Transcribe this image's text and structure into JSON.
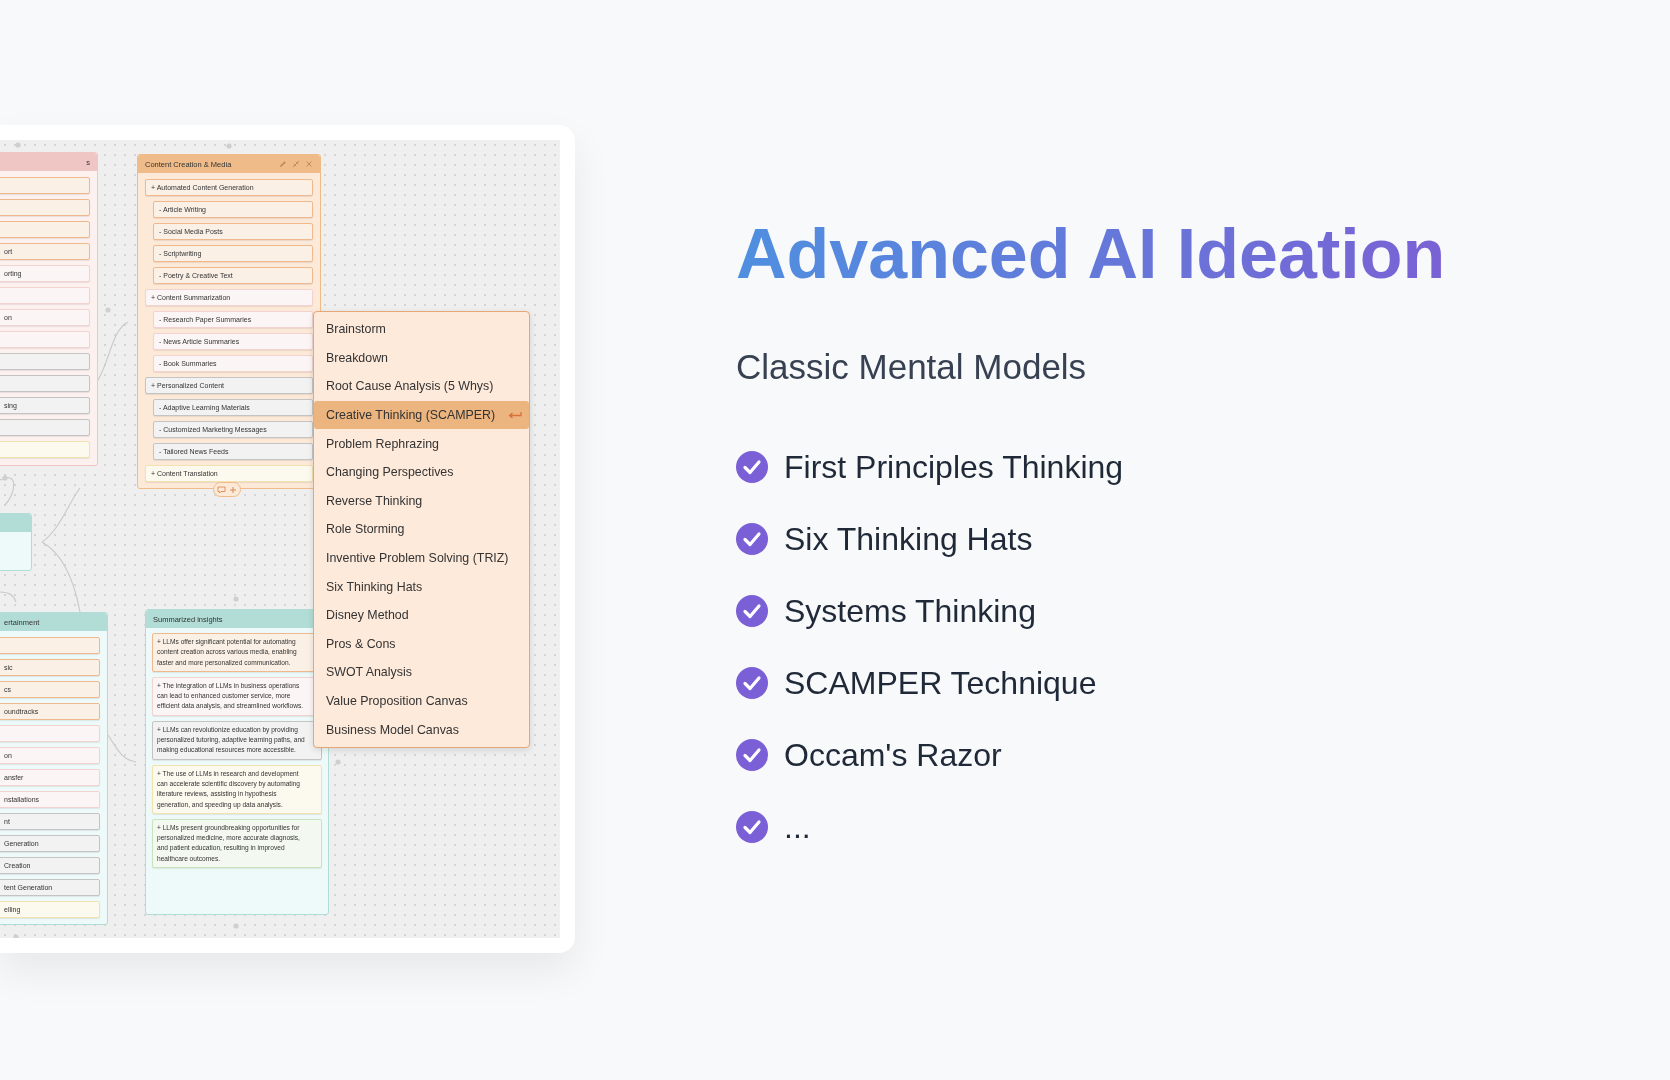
{
  "canvas": {
    "partial_node_top": {
      "title": "s",
      "rows": [
        {
          "color": "#efb98d"
        },
        {
          "color": "#efb98d"
        },
        {
          "color": "#efb98d"
        },
        {
          "text": "ort",
          "color": "#efb98d"
        },
        {
          "text": "orting",
          "color": "#f1d3d0"
        },
        {
          "color": "#f1d3d0"
        },
        {
          "text": "on",
          "color": "#f1d3d0"
        },
        {
          "color": "#f1d3d0"
        },
        {
          "color": "#c4c4c4"
        },
        {
          "color": "#c4c4c4"
        },
        {
          "text": "sing",
          "color": "#c4c4c4"
        },
        {
          "color": "#c4c4c4"
        },
        {
          "color": "#f1e2b0"
        }
      ]
    },
    "partial_node_bottom": {
      "title": "ertainment",
      "rows": [
        {
          "color": "#efb98d"
        },
        {
          "text": "sic",
          "color": "#efb98d"
        },
        {
          "text": "cs",
          "color": "#efb98d"
        },
        {
          "text": "oundtracks",
          "color": "#efb98d"
        },
        {
          "color": "#f1d3d0"
        },
        {
          "text": "on",
          "color": "#f1d3d0"
        },
        {
          "text": "ansfer",
          "color": "#f1d3d0"
        },
        {
          "text": "nstallations",
          "color": "#f1d3d0"
        },
        {
          "text": "nt",
          "color": "#c4c4c4"
        },
        {
          "text": "Generation",
          "color": "#c4c4c4"
        },
        {
          "text": "Creation",
          "color": "#c4c4c4"
        },
        {
          "text": "tent Generation",
          "color": "#c4c4c4"
        },
        {
          "text": "elling",
          "color": "#f1e2b0"
        }
      ]
    },
    "content_node": {
      "title": "Content Creation & Media",
      "groups": [
        {
          "label": "+ Automated Content Generation",
          "color": "#efb98d",
          "children": [
            "- Article Writing",
            "- Social Media Posts",
            "- Scriptwriting",
            "- Poetry & Creative Text"
          ]
        },
        {
          "label": "+ Content Summarization",
          "color": "#f1d3d0",
          "children": [
            "- Research Paper Summaries",
            "- News Article Summaries",
            "- Book Summaries"
          ]
        },
        {
          "label": "+ Personalized Content",
          "color": "#c4c4c4",
          "children": [
            "- Adaptive Learning Materials",
            "- Customized Marketing Messages",
            "- Tailored News Feeds"
          ]
        },
        {
          "label": "+ Content Translation",
          "color": "#f1e2b0"
        }
      ]
    },
    "insights_node": {
      "title": "Summarized insights",
      "cards": [
        {
          "text": "+ LLMs offer significant potential for automating content creation across various media, enabling faster and more personalized communication.",
          "color": "#efb98d"
        },
        {
          "text": "+ The integration of LLMs in business operations can lead to enhanced customer service, more efficient data analysis, and streamlined workflows.",
          "color": "#f1d3d0"
        },
        {
          "text": "+ LLMs can revolutionize education by providing personalized tutoring, adaptive learning paths, and making educational resources more accessible.",
          "color": "#c4c4c4"
        },
        {
          "text": "+ The use of LLMs in research and development can accelerate scientific discovery by automating literature reviews, assisting in hypothesis generation, and speeding up data analysis.",
          "color": "#f1e2b0"
        },
        {
          "text": "+ LLMs present groundbreaking opportunities for personalized medicine, more accurate diagnosis, and patient education, resulting in improved healthcare outcomes.",
          "color": "#c9e4bd"
        }
      ]
    },
    "menu": {
      "items": [
        {
          "label": "Brainstorm",
          "selected": false
        },
        {
          "label": "Breakdown",
          "selected": false
        },
        {
          "label": "Root Cause Analysis (5 Whys)",
          "selected": false
        },
        {
          "label": "Creative Thinking (SCAMPER)",
          "selected": true
        },
        {
          "label": "Problem Rephrazing",
          "selected": false
        },
        {
          "label": "Changing Perspectives",
          "selected": false
        },
        {
          "label": "Reverse Thinking",
          "selected": false
        },
        {
          "label": "Role Storming",
          "selected": false
        },
        {
          "label": "Inventive Problem Solving (TRIZ)",
          "selected": false
        },
        {
          "label": "Six Thinking Hats",
          "selected": false
        },
        {
          "label": "Disney Method",
          "selected": false
        },
        {
          "label": "Pros & Cons",
          "selected": false
        },
        {
          "label": "SWOT Analysis",
          "selected": false
        },
        {
          "label": "Value Proposition Canvas",
          "selected": false
        },
        {
          "label": "Business Model Canvas",
          "selected": false
        }
      ]
    }
  },
  "headline": "Advanced AI Ideation",
  "subtitle": "Classic Mental Models",
  "models": [
    "First Principles Thinking",
    "Six Thinking Hats",
    "Systems Thinking",
    "SCAMPER Technique",
    "Occam's Razor",
    "..."
  ]
}
